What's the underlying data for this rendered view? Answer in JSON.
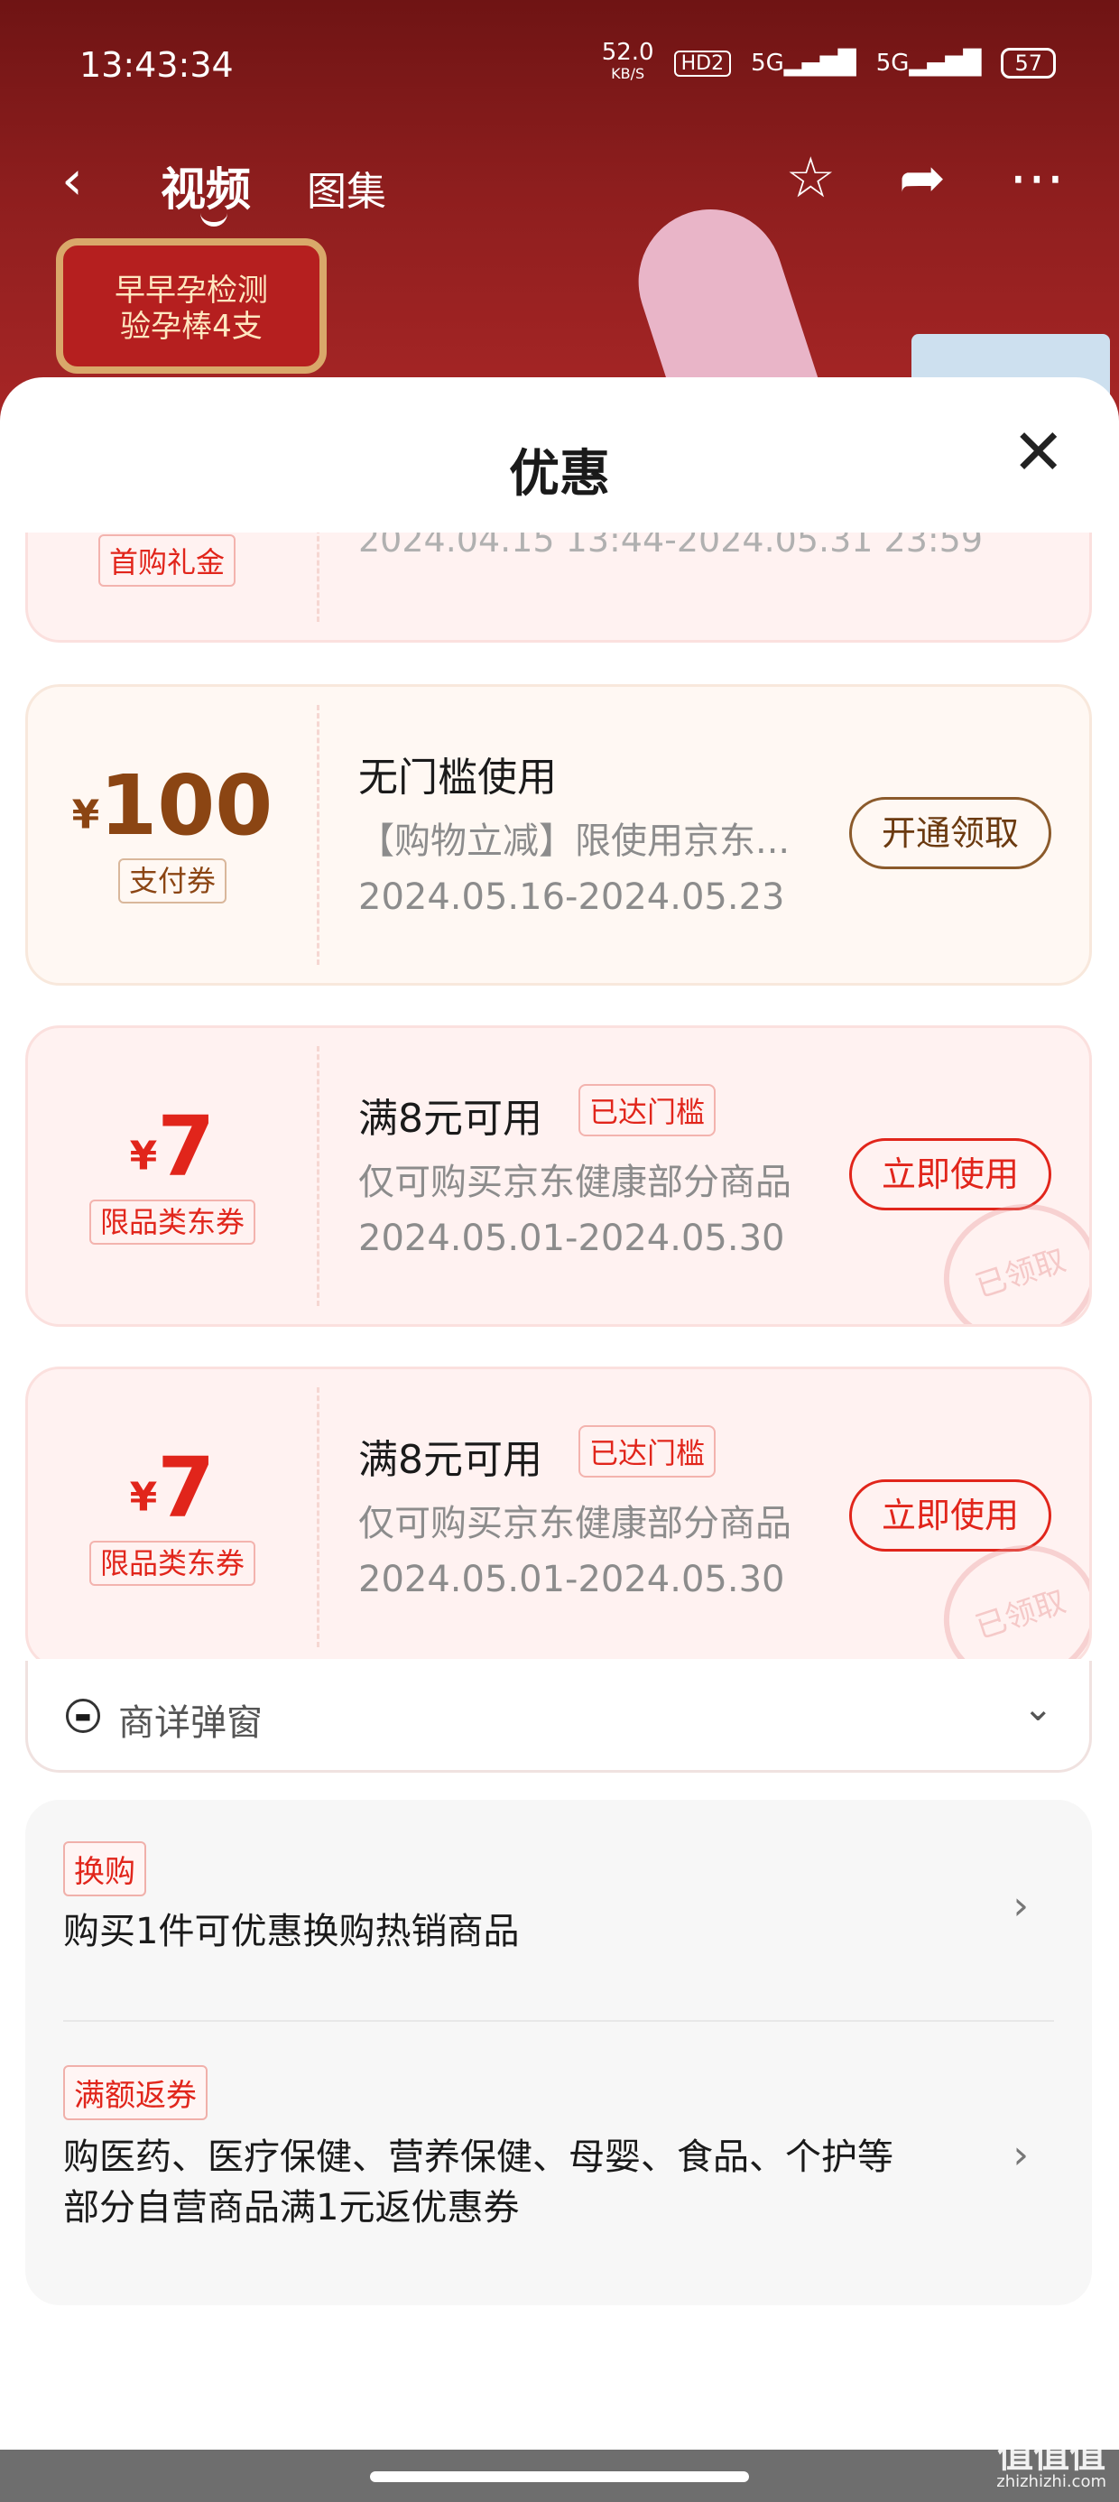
{
  "status_bar": {
    "time": "13:43:34",
    "net_speed": "52.0",
    "net_unit": "KB/S",
    "hd": "HD2",
    "signal1": "5G",
    "signal2": "5G",
    "battery": "57"
  },
  "nav": {
    "tab_video": "视频",
    "tab_album": "图集"
  },
  "promo_badge": {
    "line1": "早早孕检测",
    "line2": "验孕棒4支"
  },
  "sheet": {
    "title": "优惠"
  },
  "partial_coupon": {
    "tag": "首购礼金",
    "date": "2024.04.15 13:44-2024.05.31 23:59"
  },
  "coupons": [
    {
      "currency": "¥",
      "amount": "100",
      "tag": "支付券",
      "title": "无门槛使用",
      "desc": "【购物立减】限使用京东...",
      "date": "2024.05.16-2024.05.23",
      "button": "开通领取"
    },
    {
      "currency": "¥",
      "amount": "7",
      "tag": "限品类东券",
      "title": "满8元可用",
      "reached": "已达门槛",
      "desc": "仅可购买京东健康部分商品",
      "date": "2024.05.01-2024.05.30",
      "button": "立即使用",
      "stamp": "已领取"
    },
    {
      "currency": "¥",
      "amount": "7",
      "tag": "限品类东券",
      "title": "满8元可用",
      "reached": "已达门槛",
      "desc": "仅可购买京东健康部分商品",
      "date": "2024.05.01-2024.05.30",
      "button": "立即使用",
      "stamp": "已领取"
    }
  ],
  "detail_row": {
    "label": "商详弹窗"
  },
  "offers": [
    {
      "tag": "换购",
      "text": "购买1件可优惠换购热销商品"
    },
    {
      "tag": "满额返券",
      "text_line1": "购医药、医疗保健、营养保健、母婴、食品、个护等",
      "text_line2": "部分自营商品满1元返优惠券"
    }
  ],
  "watermark": {
    "main": "值值值",
    "sub": "zhizhizhi.com"
  },
  "colors": {
    "accent_red": "#e1251b",
    "brown": "#8b4513",
    "header_bg": "#8e1e1e"
  }
}
